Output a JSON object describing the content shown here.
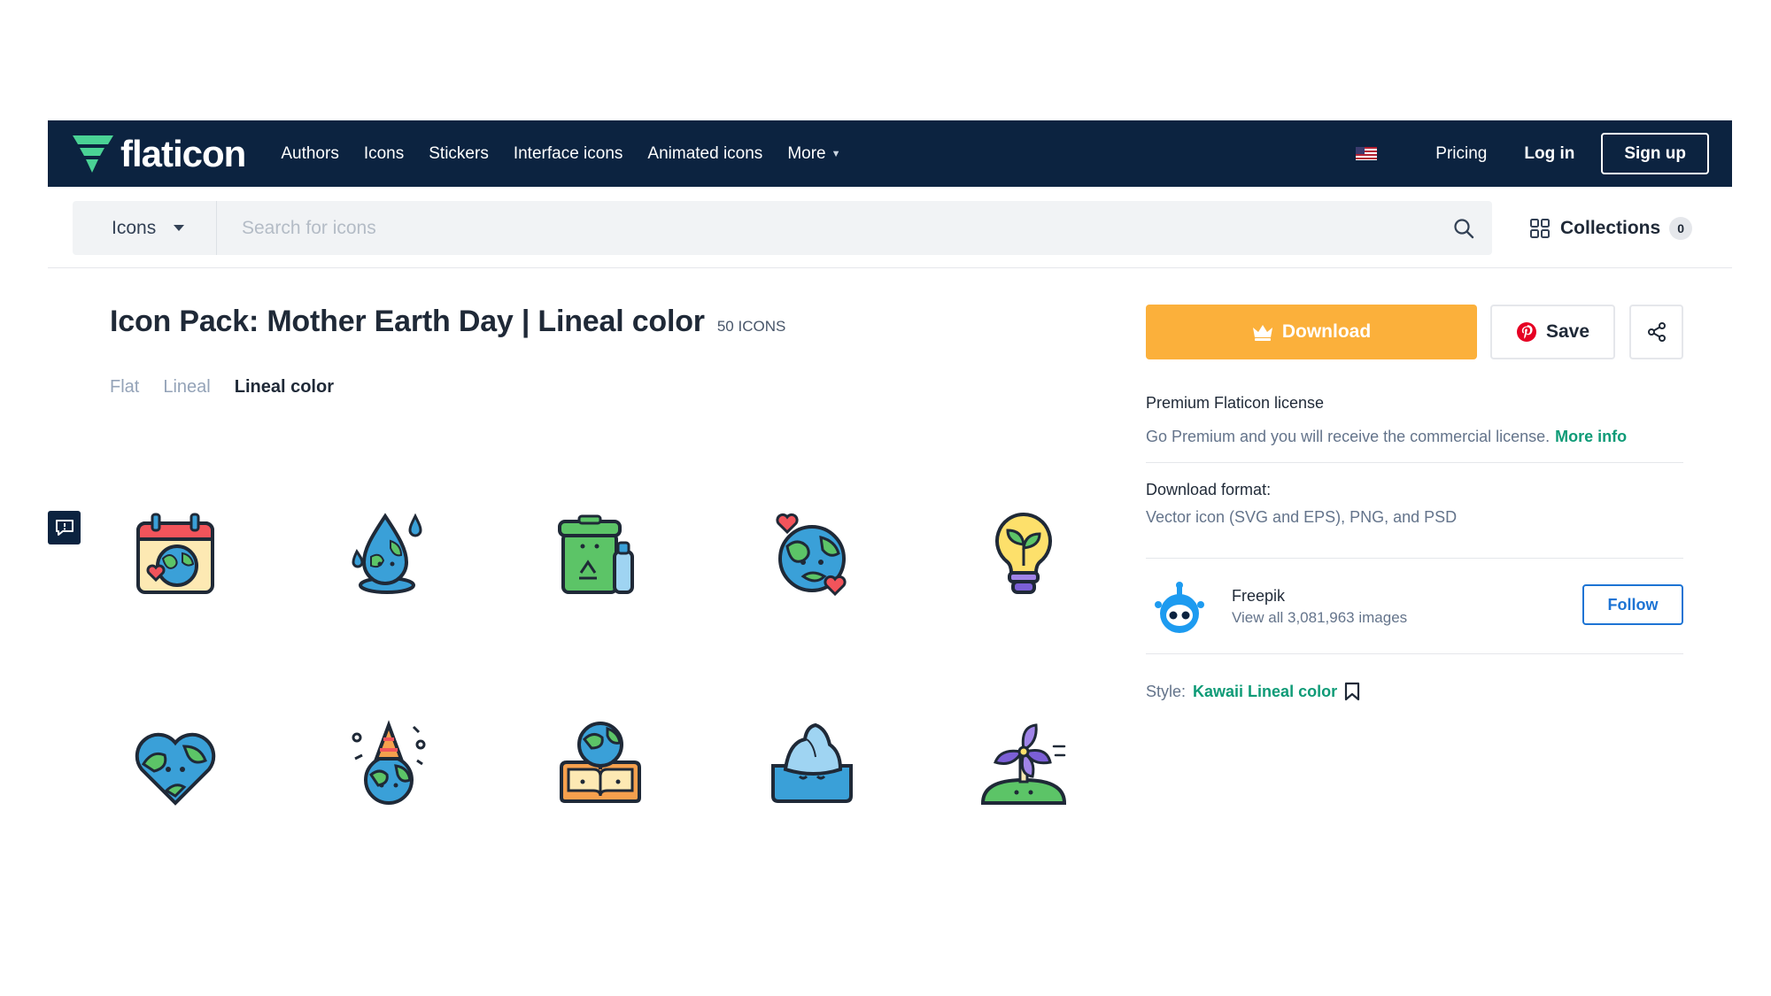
{
  "nav": {
    "logo_text": "flaticon",
    "menu": [
      {
        "label": "Authors"
      },
      {
        "label": "Icons"
      },
      {
        "label": "Stickers"
      },
      {
        "label": "Interface icons"
      },
      {
        "label": "Animated icons"
      },
      {
        "label": "More"
      }
    ],
    "pricing": "Pricing",
    "login": "Log in",
    "signup": "Sign up"
  },
  "search": {
    "type": "Icons",
    "placeholder": "Search for icons",
    "value": ""
  },
  "collections": {
    "label": "Collections",
    "count": "0"
  },
  "pack": {
    "title": "Icon Pack: Mother Earth Day | Lineal color",
    "count": "50 ICONS",
    "styles": [
      {
        "label": "Flat",
        "active": false
      },
      {
        "label": "Lineal",
        "active": false
      },
      {
        "label": "Lineal color",
        "active": true
      }
    ],
    "icons": [
      "calendar-earth-icon",
      "earth-water-drop-icon",
      "recycle-bin-icon",
      "earth-hearts-icon",
      "eco-bulb-icon",
      "heart-earth-icon",
      "party-earth-icon",
      "earth-book-icon",
      "iceberg-icon",
      "windmill-hill-icon"
    ]
  },
  "actions": {
    "download": "Download",
    "save": "Save"
  },
  "license": {
    "title": "Premium Flaticon license",
    "desc": "Go Premium and you will receive the commercial license.",
    "more": "More info"
  },
  "format": {
    "title": "Download format:",
    "desc": "Vector icon (SVG and EPS), PNG, and PSD"
  },
  "author": {
    "name": "Freepik",
    "sub": "View all 3,081,963 images",
    "follow": "Follow"
  },
  "style_info": {
    "label": "Style:",
    "value": "Kawaii Lineal color"
  },
  "colors": {
    "navy": "#0c2340",
    "accent_orange": "#fbb03b",
    "link_green": "#0f9b77",
    "follow_blue": "#1d74d4",
    "pinterest_red": "#e60023"
  }
}
